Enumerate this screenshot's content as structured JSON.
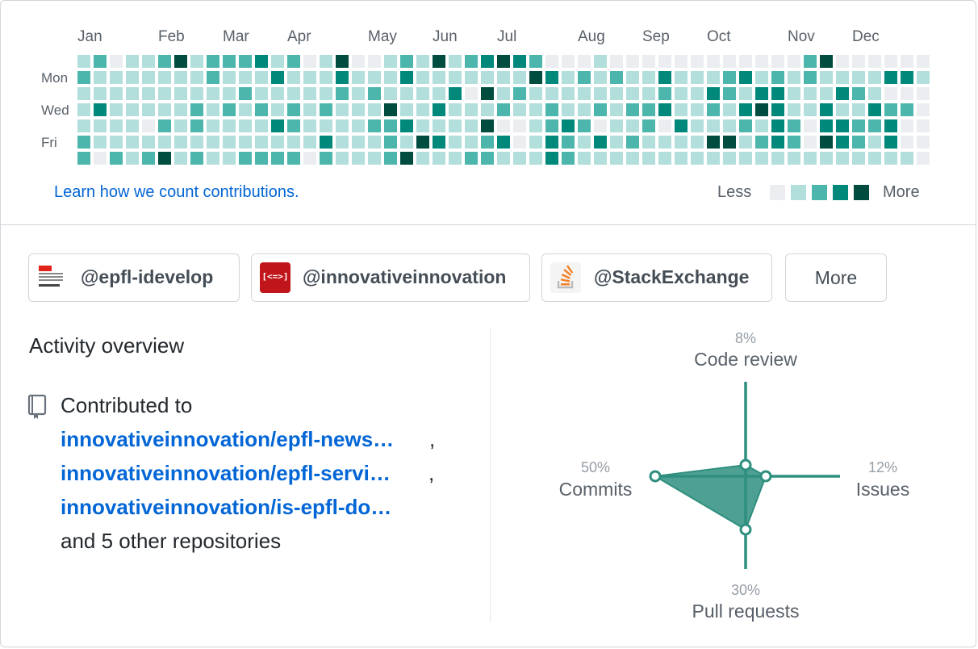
{
  "calendar": {
    "months": [
      "Jan",
      "Feb",
      "Mar",
      "Apr",
      "May",
      "Jun",
      "Jul",
      "Aug",
      "Sep",
      "Oct",
      "Nov",
      "Dec"
    ],
    "day_labels": [
      "Mon",
      "Wed",
      "Fri"
    ],
    "learn_link": "Learn how we count contributions.",
    "legend_less": "Less",
    "legend_more": "More",
    "colors": [
      "#ebedf0",
      "#b2dfdb",
      "#4db6ac",
      "#00897b",
      "#004d40"
    ],
    "levels": [
      [
        1,
        2,
        0,
        1,
        1,
        2,
        4,
        1,
        2,
        2,
        2,
        3,
        1,
        2,
        0,
        1,
        4,
        0,
        0,
        1,
        2,
        1,
        4,
        1,
        2,
        3,
        4,
        3,
        2,
        0,
        0,
        0,
        1,
        0,
        0,
        0,
        0,
        0,
        0,
        0,
        0,
        0,
        0,
        0,
        0,
        2,
        4,
        0,
        0,
        0,
        0,
        0,
        0
      ],
      [
        2,
        1,
        1,
        1,
        1,
        1,
        1,
        1,
        2,
        1,
        1,
        1,
        3,
        1,
        1,
        1,
        3,
        1,
        1,
        1,
        3,
        1,
        1,
        1,
        1,
        1,
        1,
        1,
        4,
        3,
        1,
        2,
        1,
        2,
        1,
        1,
        3,
        1,
        1,
        1,
        2,
        3,
        1,
        2,
        1,
        2,
        1,
        1,
        1,
        1,
        3,
        3,
        1
      ],
      [
        1,
        1,
        1,
        1,
        1,
        1,
        1,
        1,
        1,
        1,
        2,
        1,
        1,
        1,
        1,
        1,
        2,
        1,
        2,
        1,
        1,
        1,
        1,
        3,
        0,
        4,
        1,
        2,
        1,
        1,
        1,
        1,
        1,
        1,
        1,
        1,
        2,
        1,
        1,
        3,
        2,
        1,
        3,
        3,
        1,
        1,
        1,
        3,
        2,
        1,
        0,
        0,
        0
      ],
      [
        1,
        3,
        1,
        1,
        1,
        1,
        1,
        2,
        1,
        2,
        1,
        2,
        1,
        2,
        1,
        2,
        1,
        1,
        1,
        4,
        1,
        1,
        3,
        1,
        1,
        1,
        2,
        1,
        1,
        2,
        1,
        1,
        2,
        1,
        2,
        2,
        3,
        1,
        1,
        2,
        1,
        3,
        4,
        3,
        1,
        1,
        3,
        1,
        1,
        3,
        2,
        2,
        0
      ],
      [
        1,
        1,
        1,
        1,
        0,
        2,
        1,
        2,
        1,
        1,
        1,
        1,
        3,
        2,
        1,
        1,
        1,
        1,
        2,
        2,
        3,
        1,
        1,
        1,
        1,
        4,
        0,
        0,
        1,
        2,
        3,
        2,
        0,
        1,
        1,
        2,
        0,
        3,
        1,
        1,
        1,
        2,
        1,
        3,
        2,
        0,
        3,
        3,
        2,
        2,
        3,
        0,
        0
      ],
      [
        2,
        1,
        1,
        1,
        1,
        1,
        1,
        1,
        1,
        1,
        1,
        1,
        1,
        1,
        1,
        3,
        1,
        1,
        1,
        2,
        1,
        4,
        3,
        1,
        1,
        2,
        3,
        0,
        1,
        3,
        2,
        1,
        3,
        1,
        2,
        1,
        1,
        1,
        1,
        4,
        4,
        1,
        2,
        3,
        2,
        0,
        4,
        3,
        2,
        1,
        3,
        0,
        0
      ],
      [
        2,
        0,
        2,
        1,
        2,
        4,
        1,
        2,
        1,
        1,
        2,
        2,
        2,
        2,
        0,
        2,
        1,
        1,
        1,
        2,
        4,
        1,
        1,
        1,
        2,
        2,
        1,
        1,
        1,
        3,
        2,
        1,
        1,
        1,
        1,
        1,
        1,
        1,
        1,
        1,
        1,
        1,
        1,
        1,
        1,
        1,
        1,
        1,
        1,
        1,
        1,
        1,
        0
      ]
    ]
  },
  "orgs": [
    {
      "label": "@epfl-idevelop"
    },
    {
      "label": "@innovativeinnovation",
      "logo_text": "[<=>]"
    },
    {
      "label": "@StackExchange"
    }
  ],
  "orgs_more": "More",
  "activity": {
    "title": "Activity overview",
    "contributed_to": "Contributed to",
    "repos": [
      "innovativeinnovation/epfl-news…",
      "innovativeinnovation/epfl-servi…",
      "innovativeinnovation/is-epfl-do…"
    ],
    "comma": ",",
    "other": "and 5 other repositories"
  },
  "radar": {
    "code_review": {
      "label": "Code review",
      "pct": "8%"
    },
    "issues": {
      "label": "Issues",
      "pct": "12%"
    },
    "pull_requests": {
      "label": "Pull requests",
      "pct": "30%"
    },
    "commits": {
      "label": "Commits",
      "pct": "50%"
    },
    "color": "#2f8f7f"
  }
}
